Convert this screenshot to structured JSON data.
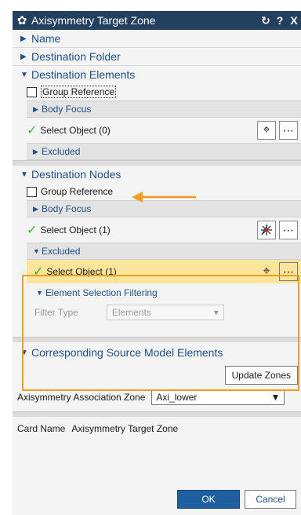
{
  "dialog": {
    "title": "Axisymmetry Target Zone",
    "title_buttons": [
      "↻",
      "?",
      "X"
    ]
  },
  "sections": {
    "name": "Name",
    "destination_folder": "Destination Folder",
    "destination_elements": "Destination Elements",
    "destination_nodes": "Destination Nodes",
    "corresponding_source": "Corresponding Source Model Elements"
  },
  "dest_elements": {
    "group_reference": "Group Reference",
    "body_focus": "Body Focus",
    "select_object": "Select Object (0)",
    "excluded": "Excluded"
  },
  "dest_nodes": {
    "group_reference": "Group Reference",
    "body_focus": "Body Focus",
    "select_object": "Select Object (1)",
    "excluded": "Excluded",
    "excluded_select": "Select Object (1)",
    "element_selection_filtering": "Element Selection Filtering",
    "filter_type_label": "Filter Type",
    "filter_type_value": "Elements"
  },
  "source": {
    "update_zones": "Update Zones",
    "association_label": "Axisymmetry Association Zone",
    "association_value": "Axi_lower"
  },
  "card": {
    "label": "Card Name",
    "value": "Axisymmetry Target Zone"
  },
  "footer": {
    "ok": "OK",
    "cancel": "Cancel"
  },
  "colors": {
    "titlebar": "#23405f",
    "accent": "#1f4f86",
    "highlight": "#fbe59b",
    "annotation": "#f39c1f",
    "check": "#3cb043"
  }
}
